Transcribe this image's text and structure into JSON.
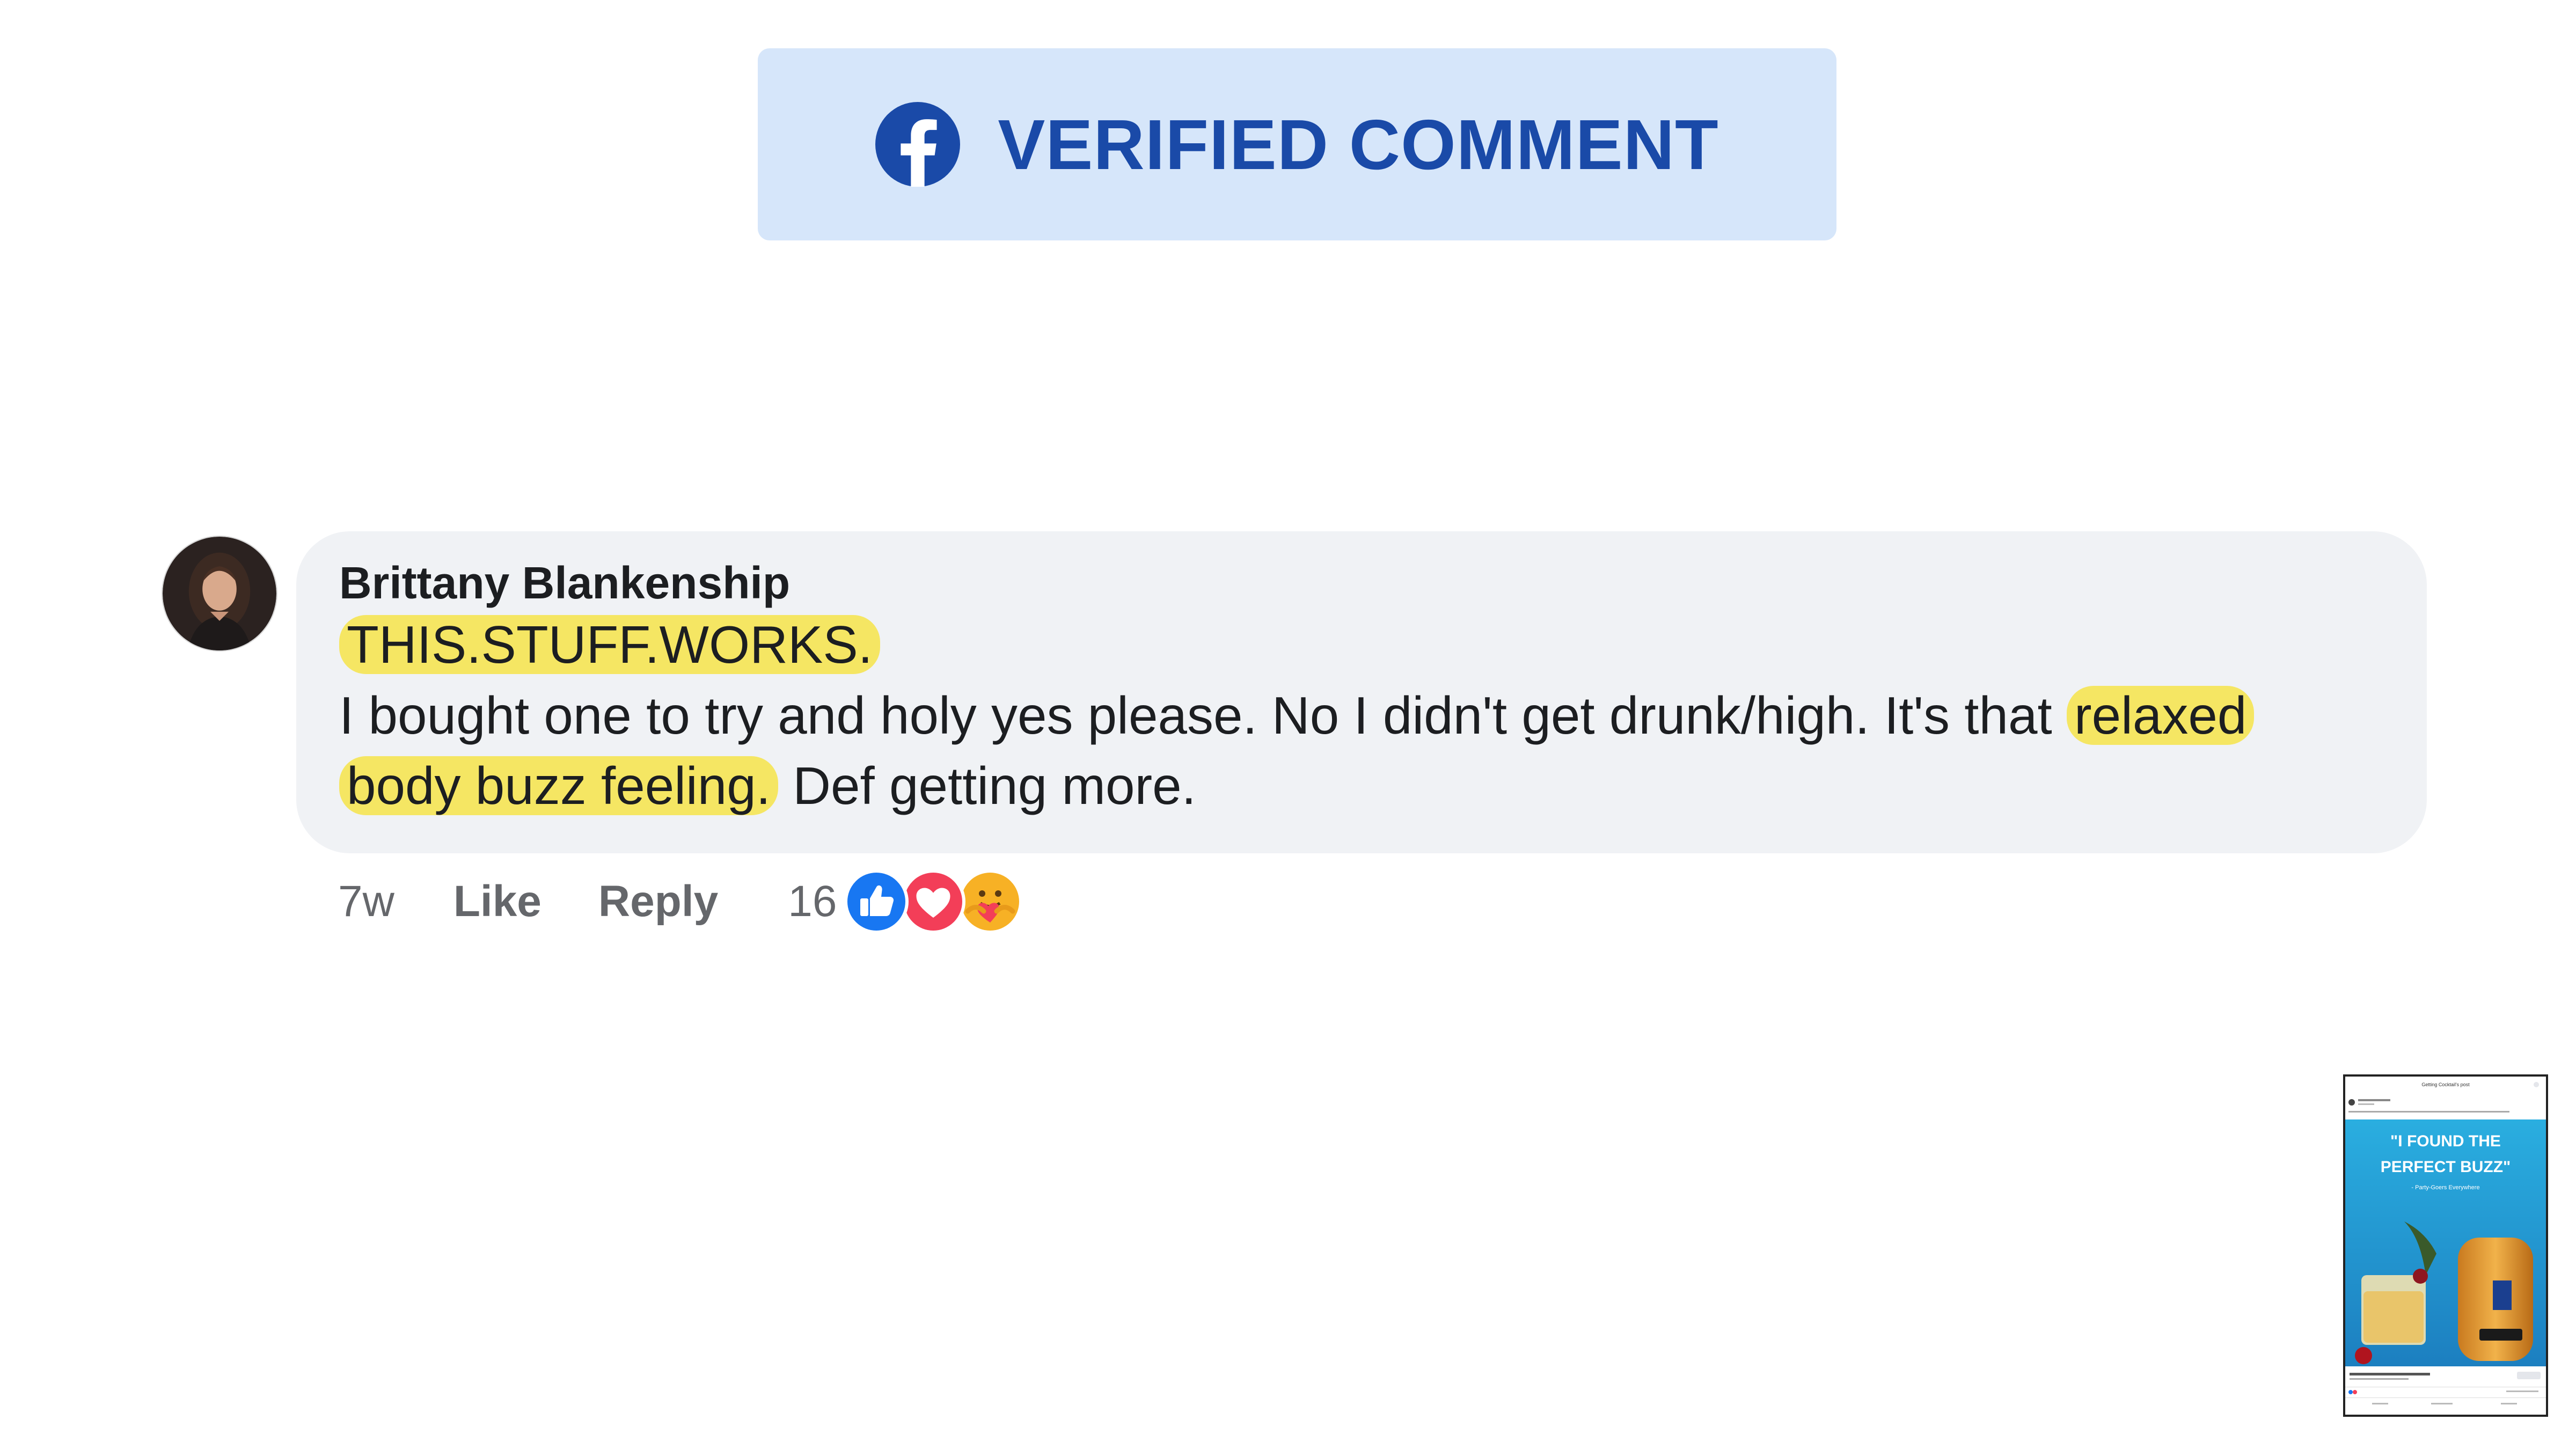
{
  "banner": {
    "icon": "facebook-icon",
    "title": "VERIFIED COMMENT",
    "accent_color": "#1a4aa8",
    "background_color": "#d6e6fa"
  },
  "comment": {
    "author": "Brittany Blankenship",
    "headline": "THIS.STUFF.WORKS.",
    "body_line_2_plain": "I bought one to try and holy yes please. No I didn't get drunk/high. It's that ",
    "body_line_2_highlight": "relaxed",
    "body_line_3_highlight": "body buzz feeling.",
    "body_line_3_plain": " Def getting more.",
    "highlight_color": "#f5e663"
  },
  "actions": {
    "time": "7w",
    "like_label": "Like",
    "reply_label": "Reply",
    "reaction_count": "16",
    "reaction_icons": [
      "like-icon",
      "love-icon",
      "care-icon"
    ]
  },
  "thumbnail": {
    "header_text": "Getting Cocktail's post",
    "headline_line_1": "\"I FOUND THE",
    "headline_line_2": "PERFECT BUZZ\"",
    "tagline": "- Party-Goers Everywhere"
  }
}
